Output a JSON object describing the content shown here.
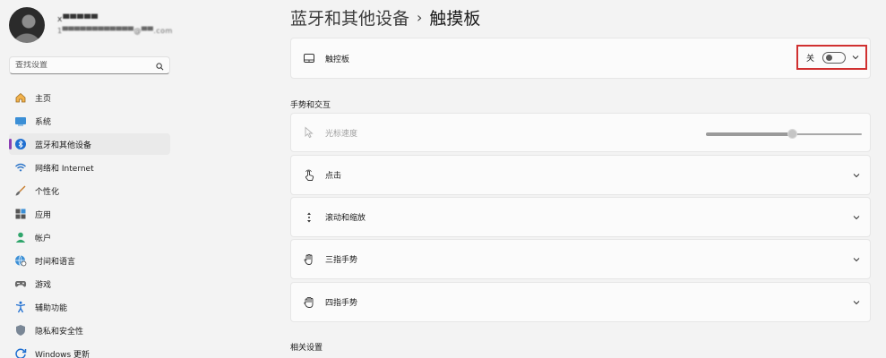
{
  "user": {
    "name": "x▀▀▀▀▀",
    "email": "1▀▀▀▀▀▀▀▀▀▀▀▀@▀▀.com"
  },
  "search": {
    "placeholder": "查找设置"
  },
  "nav": [
    {
      "label": "主页",
      "icon": "home-icon"
    },
    {
      "label": "系统",
      "icon": "monitor-icon"
    },
    {
      "label": "蓝牙和其他设备",
      "icon": "bluetooth-icon",
      "active": true
    },
    {
      "label": "网络和 Internet",
      "icon": "wifi-icon"
    },
    {
      "label": "个性化",
      "icon": "brush-icon"
    },
    {
      "label": "应用",
      "icon": "apps-icon"
    },
    {
      "label": "帐户",
      "icon": "person-icon"
    },
    {
      "label": "时间和语言",
      "icon": "globe-clock-icon"
    },
    {
      "label": "游戏",
      "icon": "gamepad-icon"
    },
    {
      "label": "辅助功能",
      "icon": "accessibility-icon"
    },
    {
      "label": "隐私和安全性",
      "icon": "shield-icon"
    },
    {
      "label": "Windows 更新",
      "icon": "update-icon"
    }
  ],
  "breadcrumb": {
    "parent": "蓝牙和其他设备",
    "separator": "›",
    "current": "触摸板"
  },
  "touchpad": {
    "label": "触控板",
    "state_text": "关",
    "enabled": false
  },
  "section_gestures": "手势和交互",
  "cursor_speed": {
    "label": "光标速度",
    "value": 0.55,
    "disabled": true
  },
  "cards": [
    {
      "label": "点击",
      "icon": "tap-icon"
    },
    {
      "label": "滚动和缩放",
      "icon": "scroll-icon"
    },
    {
      "label": "三指手势",
      "icon": "three-finger-icon"
    },
    {
      "label": "四指手势",
      "icon": "four-finger-icon"
    }
  ],
  "section_related": "相关设置",
  "colors": {
    "accent": "#8b3fb4",
    "highlight_border": "#d03030",
    "background": "#f3f3f3",
    "card": "#fbfbfb"
  }
}
